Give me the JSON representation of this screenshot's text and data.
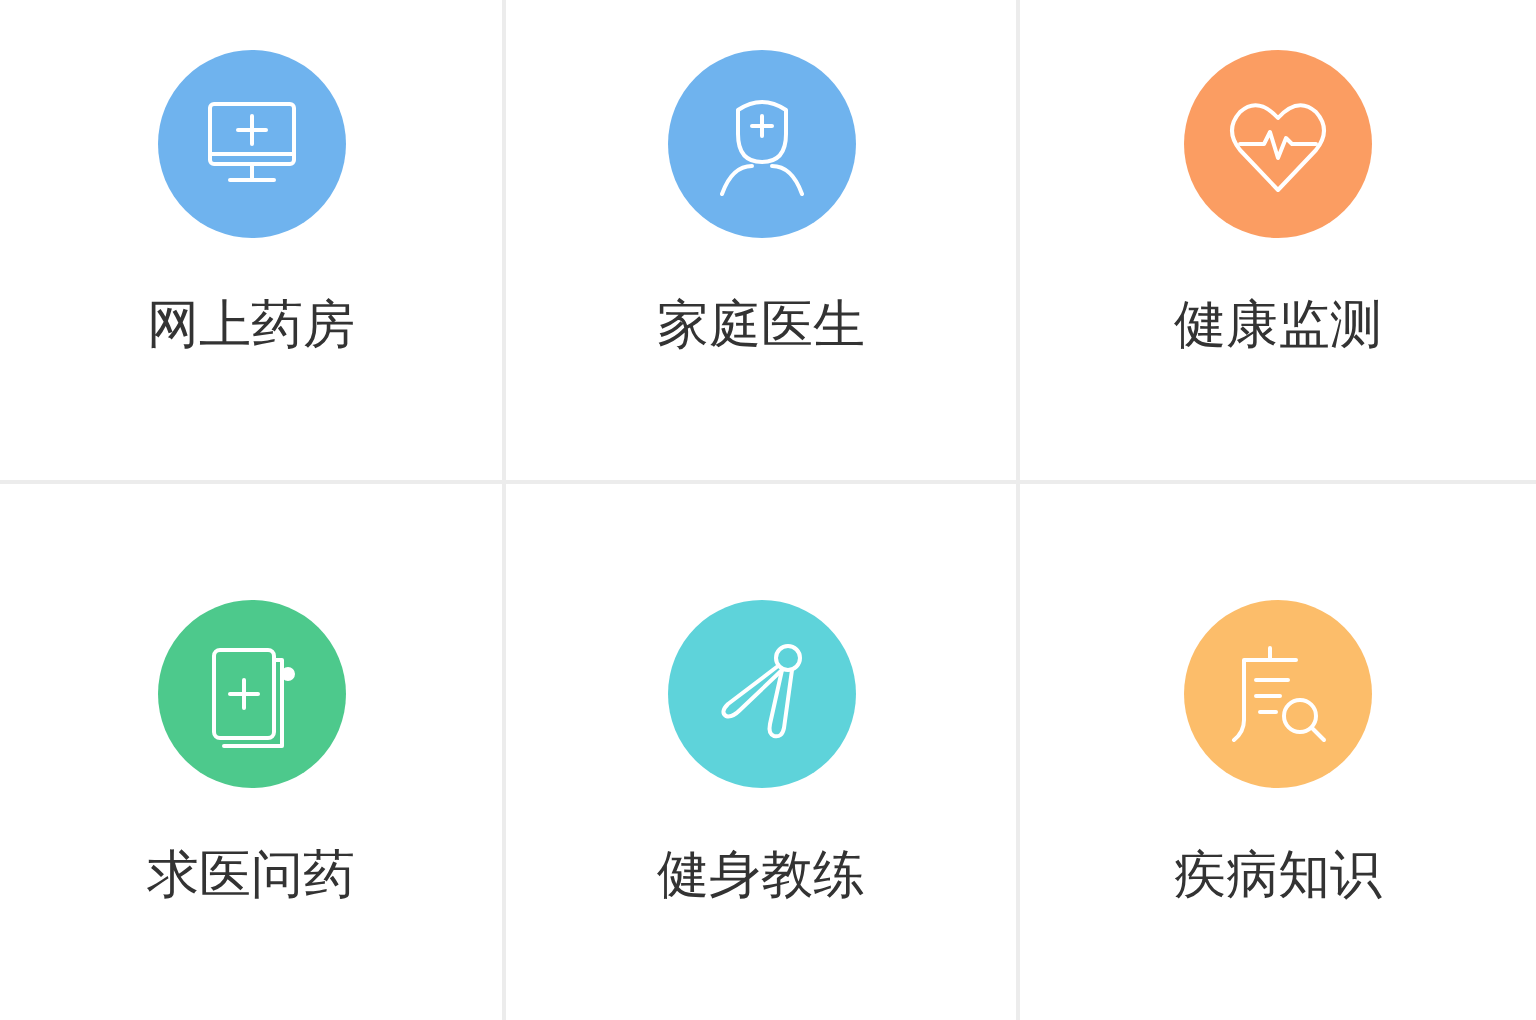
{
  "services": [
    {
      "label": "网上药房",
      "kind": "monitor",
      "color": "#6fb3ee"
    },
    {
      "label": "家庭医生",
      "kind": "doctor",
      "color": "#6fb3ee"
    },
    {
      "label": "健康监测",
      "kind": "heart",
      "color": "#fb9d62"
    },
    {
      "label": "求医问药",
      "kind": "document",
      "color": "#4dc98c"
    },
    {
      "label": "健身教练",
      "kind": "grip",
      "color": "#5ed3da"
    },
    {
      "label": "疾病知识",
      "kind": "magnifier",
      "color": "#fcbd6a"
    }
  ]
}
